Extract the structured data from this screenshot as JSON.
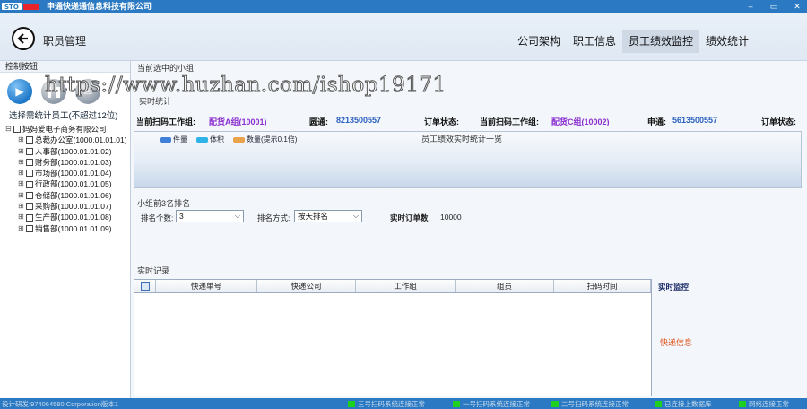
{
  "app": {
    "title": "申通快递通信息科技有限公司",
    "window_controls": [
      "–",
      "▭",
      "✕"
    ]
  },
  "header": {
    "page_title": "职员管理",
    "nav": [
      {
        "label": "公司架构",
        "active": false
      },
      {
        "label": "职工信息",
        "active": false
      },
      {
        "label": "员工绩效监控",
        "active": true
      },
      {
        "label": "绩效统计",
        "active": false
      }
    ]
  },
  "left": {
    "control_title": "控制按钮",
    "choose_label": "选择需统计员工(不超过12位)",
    "tree_root": "妈妈爱电子商务有限公司",
    "tree_children": [
      "总裁办公室(1000.01.01.01)",
      "人事部(1000.01.01.02)",
      "财务部(1000.01.01.03)",
      "市场部(1000.01.01.04)",
      "行政部(1000.01.01.05)",
      "仓储部(1000.01.01.06)",
      "采购部(1000.01.01.07)",
      "生产部(1000.01.01.08)",
      "销售部(1000.01.01.09)"
    ]
  },
  "right": {
    "current_group_label": "当前选中的小组",
    "realtime_title": "实时统计",
    "info": {
      "group1_label": "当前扫码工作组:",
      "group1_value": "配货A组(10001)",
      "express1_label": "圆通:",
      "express1_value": "8213500557",
      "status1_label": "订单状态:",
      "group2_label": "当前扫码工作组:",
      "group2_value": "配货C组(10002)",
      "express2_label": "申通:",
      "express2_value": "5613500557",
      "status2_label": "订单状态:"
    },
    "chart": {
      "title": "员工绩效实时统计一览",
      "legend": [
        {
          "label": "件量",
          "color": "#3f7fd8"
        },
        {
          "label": "体积",
          "color": "#2eb3e8"
        },
        {
          "label": "数量(提示0.1倍)",
          "color": "#e8a24a"
        }
      ]
    },
    "rank": {
      "title": "小组前3名排名",
      "count_label": "排名个数:",
      "count_value": "3",
      "mode_label": "排名方式:",
      "mode_value": "按天排名",
      "orders_label": "实时订单数",
      "orders_value": "10000"
    },
    "log": {
      "title": "实时记录",
      "columns": [
        "快递单号",
        "快递公司",
        "工作组",
        "组员",
        "扫码时间"
      ],
      "side_hint": "实时监控",
      "express_info": "快递信息"
    }
  },
  "statusbar": {
    "left": "设计研发:974064580 Corporation版本1",
    "items": [
      "三号扫码系统连接正常",
      "一号扫码系统连接正常",
      "二号扫码系统连接正常",
      "已连接上数据库",
      "网络连接正常"
    ]
  },
  "watermark": "https://www.huzhan.com/ishop19171"
}
